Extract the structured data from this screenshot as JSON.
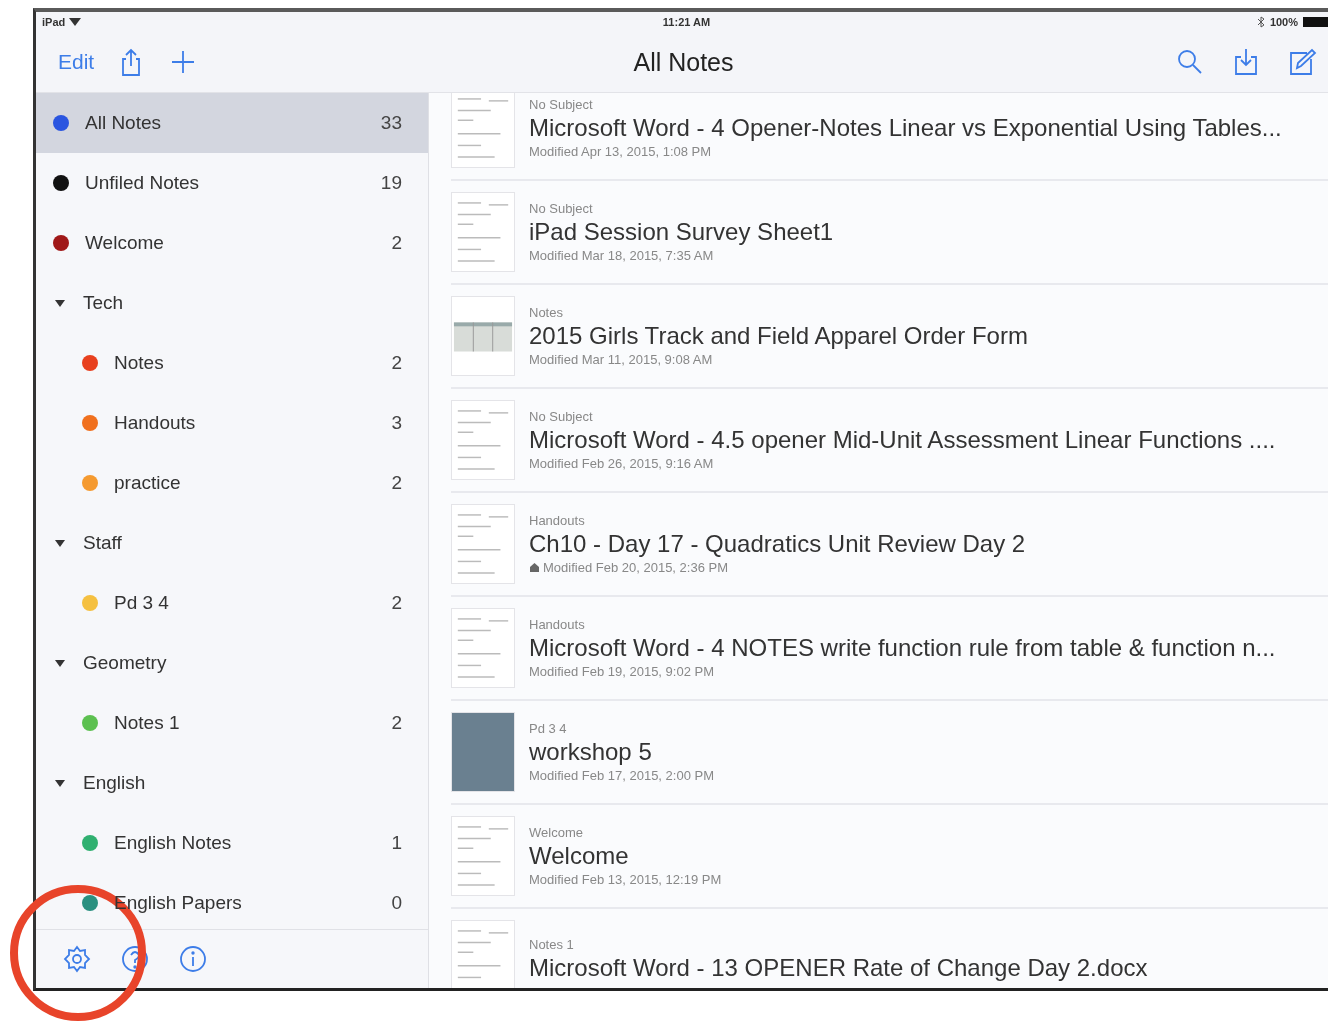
{
  "status_bar": {
    "device": "iPad",
    "time": "11:21 AM",
    "battery": "100%"
  },
  "nav_bar": {
    "edit": "Edit",
    "title": "All Notes"
  },
  "sidebar": {
    "items": [
      {
        "label": "All Notes",
        "count": "33",
        "color": "#2a55e0",
        "selected": true
      },
      {
        "label": "Unfiled Notes",
        "count": "19",
        "color": "#111111",
        "selected": false
      },
      {
        "label": "Welcome",
        "count": "2",
        "color": "#a01818",
        "selected": false
      },
      {
        "label": "Tech",
        "expanded": true,
        "selected": false,
        "children": [
          {
            "label": "Notes",
            "count": "2",
            "color": "#e8401e",
            "selected": false
          },
          {
            "label": "Handouts",
            "count": "3",
            "color": "#f0701e",
            "selected": false
          },
          {
            "label": "practice",
            "count": "2",
            "color": "#f59a30",
            "selected": false
          }
        ]
      },
      {
        "label": "Staff",
        "expanded": true,
        "selected": false,
        "children": [
          {
            "label": "Pd 3 4",
            "count": "2",
            "color": "#f5c040",
            "selected": false
          }
        ]
      },
      {
        "label": "Geometry",
        "expanded": true,
        "selected": false,
        "children": [
          {
            "label": "Notes 1",
            "count": "2",
            "color": "#5cc050",
            "selected": false
          }
        ]
      },
      {
        "label": "English",
        "expanded": true,
        "selected": false,
        "children": [
          {
            "label": "English Notes",
            "count": "1",
            "color": "#30b070",
            "selected": false
          },
          {
            "label": "English Papers",
            "count": "0",
            "color": "#2a9080",
            "selected": false
          }
        ]
      }
    ]
  },
  "notes": [
    {
      "notebook": "No Subject",
      "title": "Microsoft Word - 4 Opener-Notes Linear vs Exponential Using Tables...",
      "modified": "Modified Apr 13, 2015, 1:08 PM",
      "kind": "document",
      "marker": false
    },
    {
      "notebook": "No Subject",
      "title": "iPad Session Survey Sheet1",
      "modified": "Modified Mar 18, 2015, 7:35 AM",
      "kind": "document",
      "marker": false
    },
    {
      "notebook": "Notes",
      "title": "2015 Girls Track and Field Apparel Order Form",
      "modified": "Modified Mar 11, 2015, 9:08 AM",
      "kind": "spreadsheet",
      "marker": false
    },
    {
      "notebook": "No Subject",
      "title": "Microsoft Word - 4.5 opener Mid-Unit Assessment Linear Functions ....",
      "modified": "Modified Feb 26, 2015, 9:16 AM",
      "kind": "document",
      "marker": false
    },
    {
      "notebook": "Handouts",
      "title": "Ch10 - Day 17 - Quadratics Unit Review Day 2",
      "modified": "Modified Feb 20, 2015, 2:36 PM",
      "kind": "document",
      "marker": true
    },
    {
      "notebook": "Handouts",
      "title": "Microsoft Word - 4 NOTES write function rule from table & function n...",
      "modified": "Modified Feb 19, 2015, 9:02 PM",
      "kind": "document",
      "marker": false
    },
    {
      "notebook": "Pd 3 4",
      "title": "workshop 5",
      "modified": "Modified Feb 17, 2015, 2:00 PM",
      "kind": "photo",
      "marker": false
    },
    {
      "notebook": "Welcome",
      "title": "Welcome",
      "modified": "Modified Feb 13, 2015, 12:19 PM",
      "kind": "document",
      "marker": false
    },
    {
      "notebook": "Notes 1",
      "title": "Microsoft Word - 13 OPENER Rate of Change Day 2.docx",
      "kind": "document"
    }
  ],
  "annotation": {
    "kind": "circle"
  }
}
